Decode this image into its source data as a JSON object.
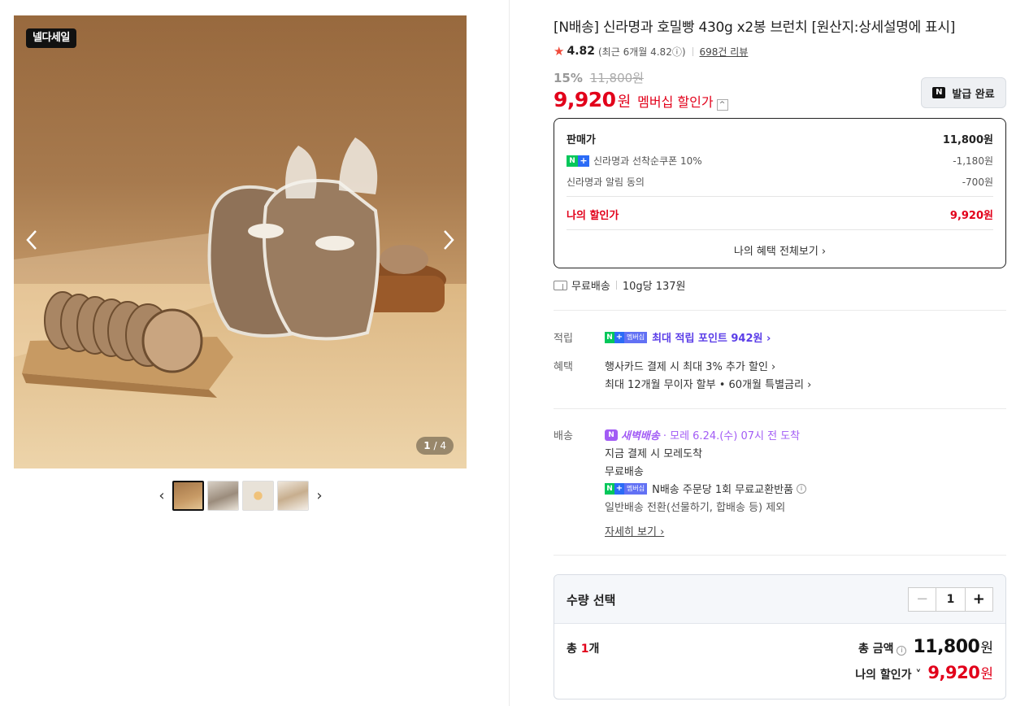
{
  "gallery": {
    "badge": "넬다세일",
    "prev_icon": "chevron-left-icon",
    "next_icon": "chevron-right-icon",
    "page_current": "1",
    "page_sep": "/",
    "page_total": "4",
    "thumbs": [
      "thumb-1",
      "thumb-2",
      "thumb-3",
      "thumb-4"
    ],
    "thumb_prev": "‹",
    "thumb_next": "›"
  },
  "product": {
    "title": "[N배송] 신라명과 호밀빵 430g x2봉 브런치 [원산지:상세설명에 표시]",
    "rating": "4.82",
    "rating_recent": "(최근 6개월 4.82ⓘ)",
    "reviews": "698건 리뷰"
  },
  "price": {
    "discount_pct": "15%",
    "original": "11,800원",
    "member_price": "9,920",
    "won": "원",
    "member_label": "멤버십 할인가",
    "caret": "^"
  },
  "coupon_button": {
    "icon": "N",
    "label": "발급 완료"
  },
  "price_box": {
    "sale_label": "판매가",
    "sale_value": "11,800원",
    "coupon_label": "신라명과 선착순쿠폰 10%",
    "coupon_value": "-1,180원",
    "alarm_label": "신라명과 알림 동의",
    "alarm_value": "-700원",
    "mine_label": "나의 할인가",
    "mine_value": "9,920원",
    "all_benefits": "나의 혜택 전체보기 ›"
  },
  "shipping_summary": {
    "free": "무료배송",
    "unit_price": "10g당 137원"
  },
  "points": {
    "label": "적립",
    "value": "최대 적립 포인트 942원 ›",
    "badge_m": "멤버십"
  },
  "benefits": {
    "label": "혜택",
    "line1": "행사카드 결제 시 최대 3% 추가 할인 ›",
    "line2": "최대 12개월 무이자 할부 • 60개월 특별금리 ›"
  },
  "delivery": {
    "label": "배송",
    "dawn_name": "새벽배송",
    "dawn_eta": "· 모레 6.24.(수) 07시 전 도착",
    "line2": "지금 결제 시 모레도착",
    "line3": "무료배송",
    "line4": "N배송 주문당 1회 무료교환반품",
    "line5": "일반배송 전환(선물하기, 합배송 등) 제외",
    "detail": "자세히 보기 ›"
  },
  "quantity": {
    "title": "수량 선택",
    "minus": "−",
    "value": "1",
    "plus": "+",
    "total_prefix": "총 ",
    "total_num": "1",
    "total_suffix": "개",
    "total_label": "총 금액",
    "total_value": "11,800",
    "won": "원",
    "mine_label": "나의 할인가 ˅",
    "mine_value": "9,920"
  },
  "colors": {
    "accent_red": "#e2001a",
    "naver_green": "#03c75a",
    "membership_purple": "#5b3ee8",
    "dawn_violet": "#a25cf5"
  }
}
